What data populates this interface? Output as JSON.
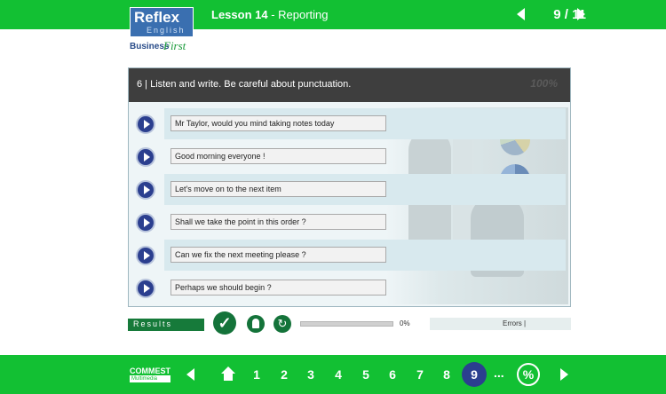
{
  "header": {
    "lesson_label": "Lesson 14",
    "lesson_topic": " - Reporting",
    "pager": "9 / 11"
  },
  "logo": {
    "brand": "Reflex",
    "language": "English",
    "line1": "Business",
    "line2": "First"
  },
  "exercise": {
    "instruction": "6 | Listen and write. Be careful about punctuation.",
    "stamp": "100%",
    "items": [
      {
        "answer": "Mr Taylor, would you mind taking notes today"
      },
      {
        "answer": "Good morning everyone !"
      },
      {
        "answer": "Let's move on to the next item"
      },
      {
        "answer": "Shall we take the point in this order ?"
      },
      {
        "answer": "Can we fix the next meeting please ?"
      },
      {
        "answer": "Perhaps we should begin ?"
      }
    ]
  },
  "results": {
    "label": "Results",
    "progress_percent": 0,
    "progress_text": "0%",
    "errors_label": "Errors |"
  },
  "footer": {
    "brand": "COMMEST",
    "brand_sub": "Multimedia",
    "pages": [
      "1",
      "2",
      "3",
      "4",
      "5",
      "6",
      "7",
      "8"
    ],
    "current_page": "9",
    "ellipsis": "...",
    "score_symbol": "%"
  },
  "colors": {
    "accent_green": "#12c033",
    "dark_green": "#14733a",
    "navy": "#2b3f8f",
    "header_dark": "#3e3e3e"
  }
}
